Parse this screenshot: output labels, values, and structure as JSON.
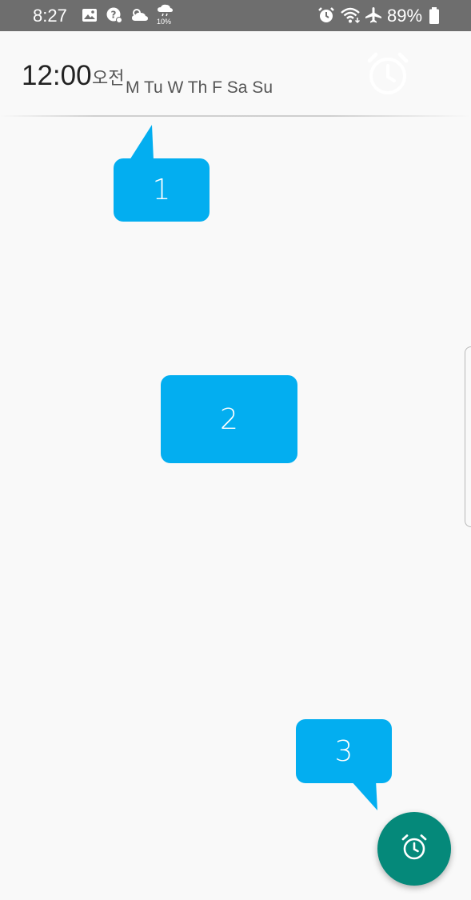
{
  "status_bar": {
    "time": "8:27",
    "weather_precip": "10%",
    "battery": "89%",
    "icons_left": [
      "gallery-icon",
      "app-notification-icon",
      "weather-cloud-icon",
      "rain-icon"
    ],
    "icons_right": [
      "alarm-status-icon",
      "wifi-icon",
      "airplane-mode-icon",
      "battery-icon"
    ]
  },
  "alarm": {
    "time": "12:00",
    "ampm": "오전",
    "days": "M Tu W Th F Sa Su",
    "enabled": false
  },
  "tutorial": {
    "step1": "1",
    "step2": "2",
    "step3": "3"
  },
  "fab": {
    "icon": "add-alarm-icon"
  },
  "colors": {
    "status_bar_bg": "#6e6e6e",
    "background": "#f9f9f9",
    "bubble": "#03aef0",
    "fab": "#05897a"
  }
}
